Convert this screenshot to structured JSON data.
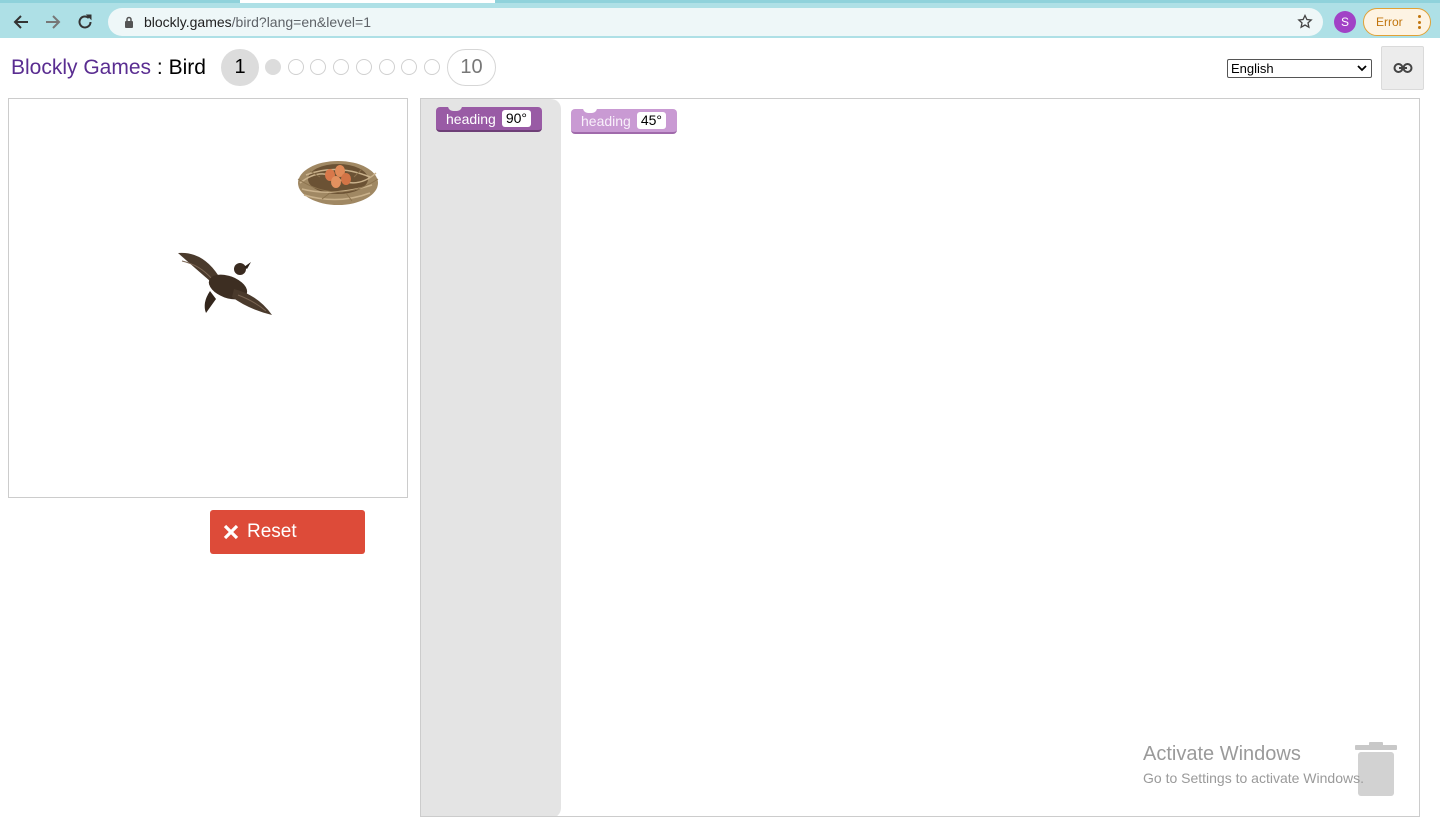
{
  "browser": {
    "url_host": "blockly.games",
    "url_path": "/bird?lang=en&level=1",
    "profile_initial": "S",
    "error_label": "Error"
  },
  "header": {
    "brand": "Blockly Games",
    "separator": " : ",
    "game": "Bird",
    "current_level": "1",
    "last_level": "10",
    "language": "English"
  },
  "controls": {
    "reset_label": "Reset"
  },
  "toolbox": {
    "block_label": "heading",
    "block_value": "90°"
  },
  "workspace": {
    "block_label": "heading",
    "block_value": "45°"
  },
  "watermark": {
    "line1": "Activate Windows",
    "line2": "Go to Settings to activate Windows."
  },
  "colors": {
    "brand": "#5a2d91",
    "reset": "#dd4b39",
    "block": "#995ba5",
    "block_disabled": "#c99ad3",
    "toolbar": "#aee0e6"
  }
}
